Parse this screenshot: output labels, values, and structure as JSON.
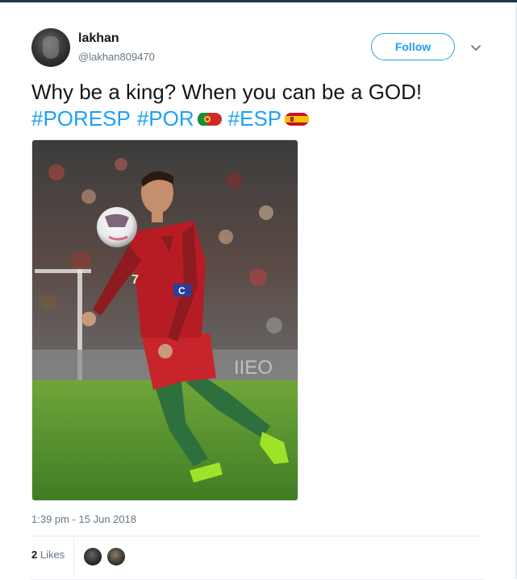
{
  "user": {
    "name": "lakhan",
    "handle": "@lakhan809470"
  },
  "follow_button": {
    "label": "Follow"
  },
  "tweet": {
    "text": "Why be a king? When you can be a GOD!",
    "hashtags": [
      "#PORESP",
      "#POR",
      "#ESP"
    ],
    "flags": [
      "portugal-flag-icon",
      "spain-flag-icon"
    ],
    "media": {
      "description": "football-player-photo"
    }
  },
  "meta": {
    "timestamp": "1:39 pm - 15 Jun 2018",
    "likes_count": "2",
    "likes_label": "Likes"
  },
  "colors": {
    "accent": "#1da1f2",
    "text": "#14171a",
    "muted": "#657786"
  }
}
